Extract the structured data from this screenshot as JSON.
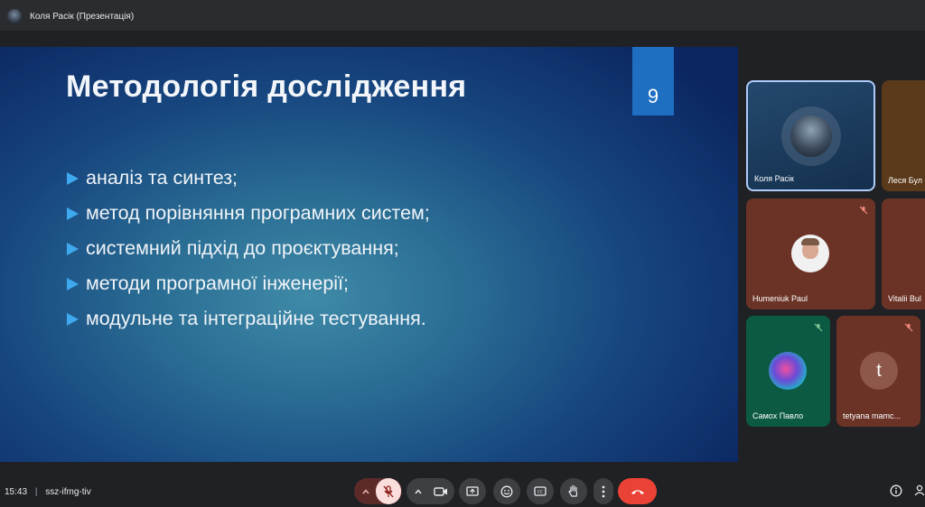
{
  "window": {
    "title": "Коля Расік (Презентація)"
  },
  "slide": {
    "title": "Методологія дослідження",
    "page_number": "9",
    "bullets": [
      "аналіз та синтез;",
      "метод порівняння програмних систем;",
      "системний підхід до проєктування;",
      "методи програмної інженерії;",
      "модульне та інтеграційне тестування."
    ]
  },
  "participants": [
    {
      "name": "Коля Расік",
      "tile_color": "#1b3a5c",
      "active": true
    },
    {
      "name": "Леся Бул",
      "tile_color": "#5a3a1a"
    },
    {
      "name": "Humeniuk Paul",
      "tile_color": "#6b3326",
      "muted": true
    },
    {
      "name": "Vitalii Bul",
      "tile_color": "#6b3326"
    },
    {
      "name": "Самох Павло",
      "tile_color": "#0c5a43",
      "muted": true
    },
    {
      "name": "tetyana mamc...",
      "tile_color": "#6b3326",
      "initial": "t",
      "muted": true
    }
  ],
  "meeting": {
    "time": "15:43",
    "separator": "|",
    "code": "ssz-ifmg-tiv"
  },
  "colors": {
    "end_call": "#ea4335",
    "mic_muted_bg": "#f9dedc",
    "mic_muted_fg": "#8c1d18",
    "muted_tile_icon": "#8c1d18"
  }
}
